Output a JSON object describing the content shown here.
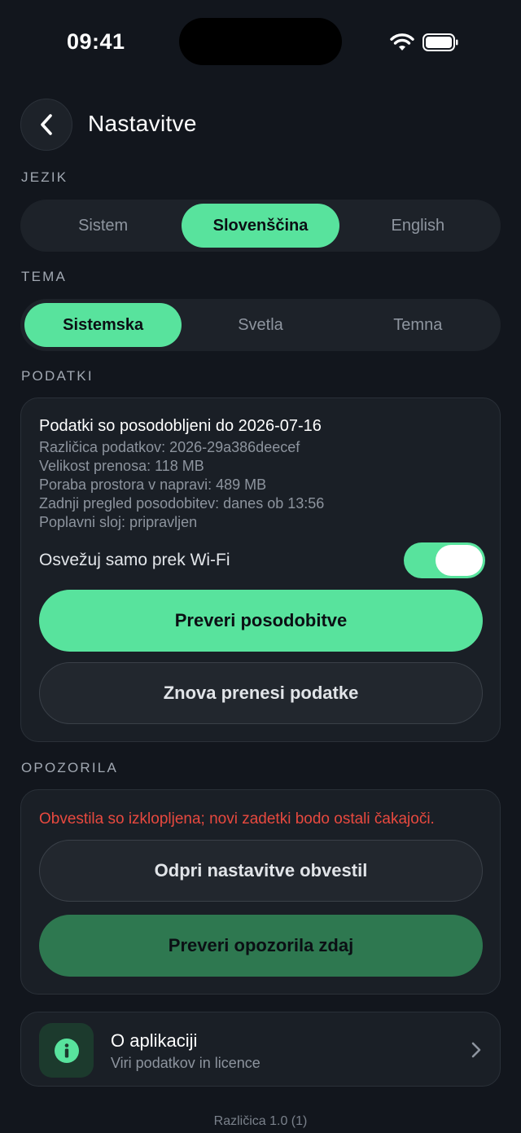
{
  "status_bar": {
    "time": "09:41"
  },
  "header": {
    "title": "Nastavitve"
  },
  "language": {
    "section_label": "JEZIK",
    "options": [
      "Sistem",
      "Slovenščina",
      "English"
    ],
    "selected": "Slovenščina"
  },
  "theme": {
    "section_label": "TEMA",
    "options": [
      "Sistemska",
      "Svetla",
      "Temna"
    ],
    "selected": "Sistemska"
  },
  "data": {
    "section_label": "PODATKI",
    "title": "Podatki so posodobljeni do 2026-07-16",
    "lines": [
      "Različica podatkov: 2026-29a386deecef",
      "Velikost prenosa: 118 MB",
      "Poraba prostora v napravi: 489 MB",
      "Zadnji pregled posodobitev: danes ob 13:56",
      "Poplavni sloj: pripravljen"
    ],
    "wifi_only_label": "Osvežuj samo prek Wi-Fi",
    "wifi_only_enabled": true,
    "check_updates_label": "Preveri posodobitve",
    "redownload_label": "Znova prenesi podatke"
  },
  "alerts": {
    "section_label": "OPOZORILA",
    "warning_text": "Obvestila so izklopljena; novi zadetki bodo ostali čakajoči.",
    "open_settings_label": "Odpri nastavitve obvestil",
    "check_now_label": "Preveri opozorila zdaj"
  },
  "about": {
    "title": "O aplikaciji",
    "subtitle": "Viri podatkov in licence"
  },
  "footer": {
    "version": "Različica 1.0 (1)"
  },
  "colors": {
    "accent": "#58e39d",
    "background": "#12161d",
    "card": "#1a1f26",
    "warning": "#e8493f"
  }
}
